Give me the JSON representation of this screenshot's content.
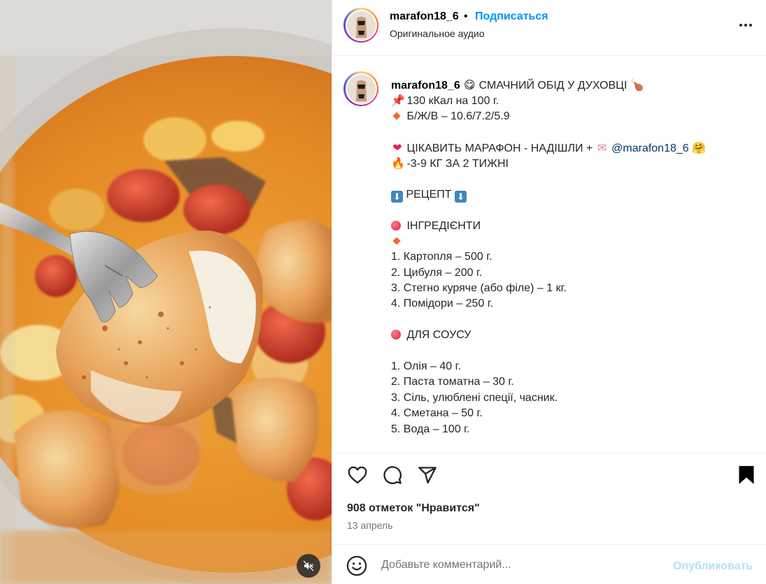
{
  "post": {
    "username": "marafon18_6",
    "follow_label": "Подписаться",
    "audio_label": "Оригинальное аудио",
    "more_icon": "more-horizontal-icon"
  },
  "caption": {
    "username": "marafon18_6",
    "title": "СМАЧНИЙ ОБІД У ДУХОВЦІ",
    "calories": "130 кКал на 100 г.",
    "macros": "Б/Ж/В – 10.6/7.2/5.9",
    "promo_text": "ЦІКАВИТЬ МАРАФОН - НАДІШЛИ +",
    "promo_mention": "@marafon18_6",
    "promo_result": "-3-9 КГ ЗА 2 ТИЖНІ",
    "recipe_header": "РЕЦЕПТ",
    "ingredients_header": "ІНГРЕДІЄНТИ",
    "ingredients": [
      "1. Картопля – 500 г.",
      "2. Цибуля – 200 г.",
      "3. Стегно куряче (або філе) – 1 кг.",
      "4. Помідори – 250 г."
    ],
    "sauce_header": "ДЛЯ СОУСУ",
    "sauce": [
      "1. Олія – 40 г.",
      "2. Паста томатна – 30 г.",
      "3. Сіль, улюблені спеції, часник.",
      "4. Сметана – 50 г.",
      "5. Вода – 100 г."
    ]
  },
  "actions": {
    "likes_text": "908 отметок \"Нравится\"",
    "date": "13 апрель"
  },
  "comment": {
    "placeholder": "Добавьте комментарий...",
    "publish_label": "Опубликовать"
  },
  "colors": {
    "link_blue": "#0095f6",
    "publish_disabled": "#b2dffc",
    "mention": "#00376b",
    "muted_text": "#737373"
  }
}
